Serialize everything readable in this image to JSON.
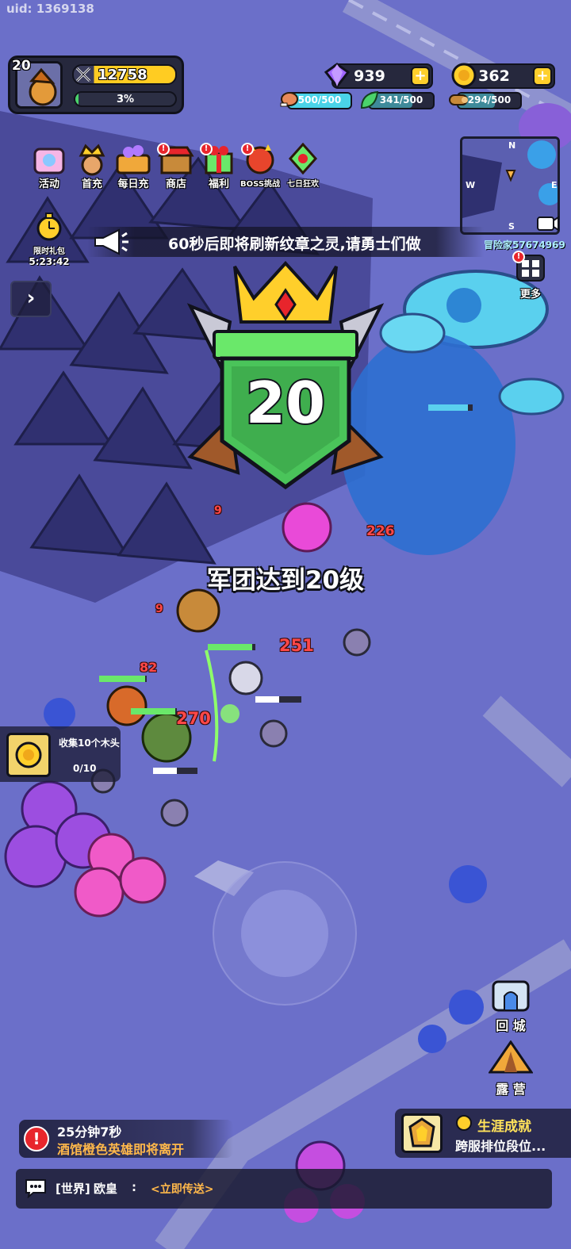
{
  "uid_text": "uid: 1369138",
  "player": {
    "level": "20",
    "power": "12758",
    "exp_percent_text": "3%",
    "exp_fraction": 0.03
  },
  "currencies": {
    "gems": "939",
    "gold": "362",
    "plus_label": "+"
  },
  "resources": {
    "meat": "500/500",
    "herb": "341/500",
    "wood": "294/500"
  },
  "menu": [
    {
      "label": "活动",
      "badge": false
    },
    {
      "label": "首充",
      "badge": false
    },
    {
      "label": "每日充",
      "badge": false
    },
    {
      "label": "商店",
      "badge": true
    },
    {
      "label": "福利",
      "badge": true
    },
    {
      "label": "BOSS挑战",
      "badge": true
    },
    {
      "label": "七日狂欢",
      "badge": false
    }
  ],
  "badge_mark": "!",
  "minimap": {
    "n": "N",
    "w": "W",
    "e": "E",
    "s": "S"
  },
  "gift": {
    "label": "限时礼包",
    "time": "5:23:42"
  },
  "announcement": "60秒后即将刷新纹章之灵,请勇士们做",
  "expand_label": "›",
  "more_label": "更多",
  "player_tag": "冒险家57674969",
  "levelup": {
    "number": "20",
    "message": "军团达到20级"
  },
  "damage_numbers": [
    "226",
    "251",
    "82",
    "270",
    "9",
    "9"
  ],
  "quest": {
    "title": "收集10个木头",
    "progress": "0/10"
  },
  "side_buttons": {
    "return_city": "回 城",
    "camp": "露 营"
  },
  "notice": {
    "timer": "25分钟7秒",
    "text": "酒馆橙色英雄即将离开",
    "mark": "!"
  },
  "achievement": {
    "title": "生涯成就",
    "subtitle": "跨服排位段位..."
  },
  "chat": {
    "channel": "[世界]",
    "name": "欧皇",
    "separator": ":",
    "link": "<立即传送>"
  },
  "colors": {
    "ground": "#6b6fc9",
    "gold": "#ffcf2b",
    "exp_green": "#4ad36b",
    "alert_red": "#e8252c",
    "damage_red": "#ff4848",
    "highlight_orange": "#ffb84a"
  }
}
